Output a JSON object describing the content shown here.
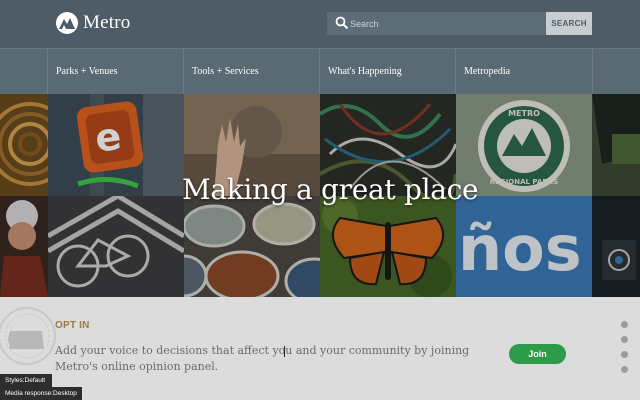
{
  "header": {
    "logo_text": "Metro",
    "search": {
      "placeholder": "Search",
      "button_label": "SEARCH"
    }
  },
  "nav": {
    "items": [
      {
        "label": "Parks + Venues"
      },
      {
        "label": "Tools + Services"
      },
      {
        "label": "What's Happening"
      },
      {
        "label": "Metropedia"
      }
    ]
  },
  "hero": {
    "title": "Making a great place",
    "tiles": [
      {
        "icon": "bamboo-texture"
      },
      {
        "icon": "letter-e-sign"
      },
      {
        "icon": "raised-hand"
      },
      {
        "icon": "wires-tangle"
      },
      {
        "icon": "metro-regional-parks-sign"
      },
      {
        "icon": "car-window"
      },
      {
        "icon": "person-with-headlamp"
      },
      {
        "icon": "bike-lane-marking"
      },
      {
        "icon": "paint-cans"
      },
      {
        "icon": "monarch-butterfly"
      },
      {
        "icon": "blue-sign-letters"
      },
      {
        "icon": "dark-tile"
      }
    ],
    "sign_letters": "ños"
  },
  "optin": {
    "heading": "OPT IN",
    "text": "Add your voice to decisions that affect you and your community by joining Metro's online opinion panel.",
    "join_label": "Join"
  },
  "pagination": {
    "dot_count": 4
  },
  "debug": {
    "styles": "Styles:Default",
    "media": "Media response:Desktop"
  },
  "colors": {
    "header_bg": "#4d5c66",
    "nav_bg": "#5a6a74",
    "optin_heading": "#9a7b3e",
    "join_button": "#2e9b4a",
    "page_bg": "#dcdcdc"
  }
}
